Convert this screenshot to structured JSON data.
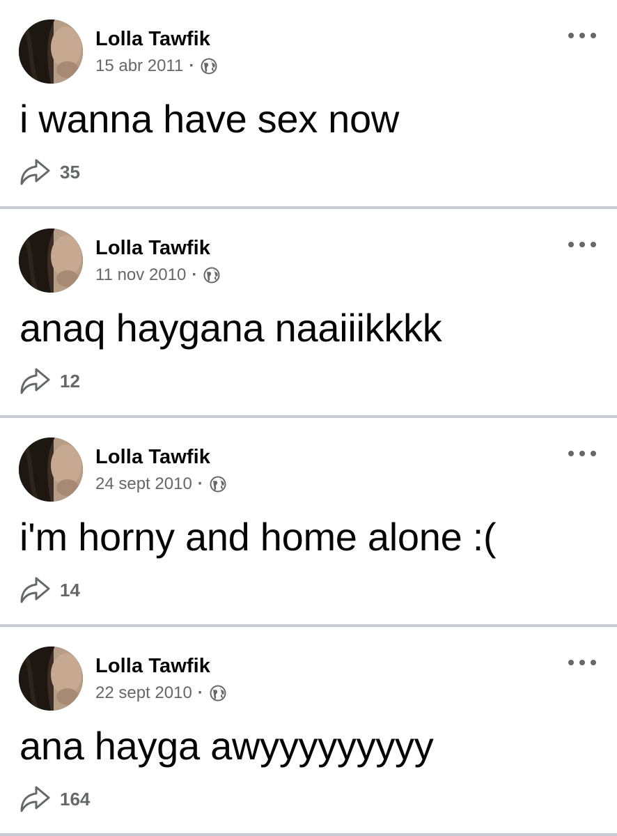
{
  "posts": [
    {
      "author": "Lolla Tawfik",
      "date": "15 abr 2011",
      "separator": "·",
      "privacy_icon": "globe-icon",
      "text": "i wanna have sex now",
      "shares": "35"
    },
    {
      "author": "Lolla Tawfik",
      "date": "11 nov 2010",
      "separator": "·",
      "privacy_icon": "globe-icon",
      "text": "anaq haygana naaiiikkkk",
      "shares": "12"
    },
    {
      "author": "Lolla Tawfik",
      "date": "24 sept 2010",
      "separator": "·",
      "privacy_icon": "globe-icon",
      "text": "i'm horny and home alone :(",
      "shares": "14"
    },
    {
      "author": "Lolla Tawfik",
      "date": "22 sept 2010",
      "separator": "·",
      "privacy_icon": "globe-icon",
      "text": "ana hayga awyyyyyyyyy",
      "shares": "164"
    }
  ],
  "icons": {
    "more": "more-options-icon",
    "share": "share-arrow-icon",
    "privacy": "globe-icon"
  },
  "colors": {
    "text": "#050505",
    "secondary": "#65676b",
    "divider": "#c9ccd1",
    "background": "#ffffff"
  }
}
